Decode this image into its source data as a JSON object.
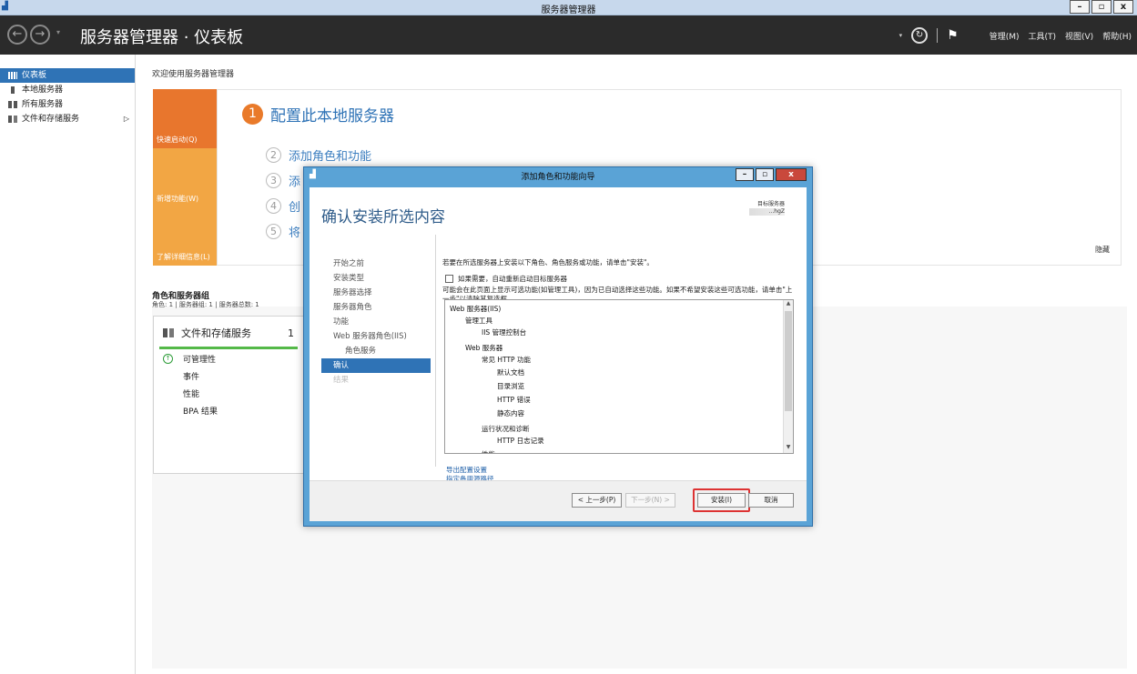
{
  "window": {
    "title": "服务器管理器"
  },
  "header": {
    "breadcrumb": "服务器管理器 · 仪表板",
    "menus": [
      "管理(M)",
      "工具(T)",
      "视图(V)",
      "帮助(H)"
    ]
  },
  "sidebar": {
    "items": [
      {
        "label": "仪表板",
        "icon": "dashboard-icon",
        "active": true
      },
      {
        "label": "本地服务器",
        "icon": "local-server-icon"
      },
      {
        "label": "所有服务器",
        "icon": "all-servers-icon"
      },
      {
        "label": "文件和存储服务",
        "icon": "file-storage-icon"
      }
    ]
  },
  "main": {
    "welcome": "欢迎使用服务器管理器",
    "tiles": [
      "快速启动(Q)",
      "新增功能(W)",
      "了解详细信息(L)"
    ],
    "steps": [
      {
        "num": "1",
        "label": "配置此本地服务器"
      },
      {
        "num": "2",
        "label": "添加角色和功能"
      },
      {
        "num": "3",
        "label": "添"
      },
      {
        "num": "4",
        "label": "创"
      },
      {
        "num": "5",
        "label": "将"
      }
    ],
    "hide": "隐藏",
    "roles_title": "角色和服务器组",
    "roles_sub": "角色: 1 | 服务器组: 1 | 服务器总数: 1",
    "role_card": {
      "name": "文件和存储服务",
      "count": "1",
      "rows": [
        "可管理性",
        "事件",
        "性能",
        "BPA 结果"
      ]
    }
  },
  "dialog": {
    "title": "添加角色和功能向导",
    "heading": "确认安装所选内容",
    "target_label": "目标服务器",
    "target_value": "...hgZ",
    "nav": [
      {
        "label": "开始之前"
      },
      {
        "label": "安装类型"
      },
      {
        "label": "服务器选择"
      },
      {
        "label": "服务器角色"
      },
      {
        "label": "功能"
      },
      {
        "label": "Web 服务器角色(IIS)"
      },
      {
        "label": "角色服务",
        "sub": true
      },
      {
        "label": "确认",
        "active": true
      },
      {
        "label": "结果",
        "disabled": true
      }
    ],
    "intro": "若要在所选服务器上安装以下角色、角色服务或功能，请单击\"安装\"。",
    "checkbox_label": "如果需要，自动重新启动目标服务器",
    "note": "可能会在此页面上显示可选功能(如管理工具)，因为已自动选择这些功能。如果不希望安装这些可选功能，请单击\"上一步\"以清除其复选框。",
    "tree": [
      {
        "label": "Web 服务器(IIS)",
        "level": 0
      },
      {
        "label": "管理工具",
        "level": 1
      },
      {
        "label": "IIS 管理控制台",
        "level": 2
      },
      {
        "label": "Web 服务器",
        "level": 1
      },
      {
        "label": "常见 HTTP 功能",
        "level": 2
      },
      {
        "label": "默认文档",
        "level": 3
      },
      {
        "label": "目录浏览",
        "level": 3
      },
      {
        "label": "HTTP 错误",
        "level": 3
      },
      {
        "label": "静态内容",
        "level": 3
      },
      {
        "label": "运行状况和诊断",
        "level": 2
      },
      {
        "label": "HTTP 日志记录",
        "level": 3
      },
      {
        "label": "性能",
        "level": 2
      }
    ],
    "links": [
      "导出配置设置",
      "指定备用源路径"
    ],
    "buttons": {
      "prev": "< 上一步(P)",
      "next": "下一步(N) >",
      "install": "安装(I)",
      "cancel": "取消"
    }
  }
}
